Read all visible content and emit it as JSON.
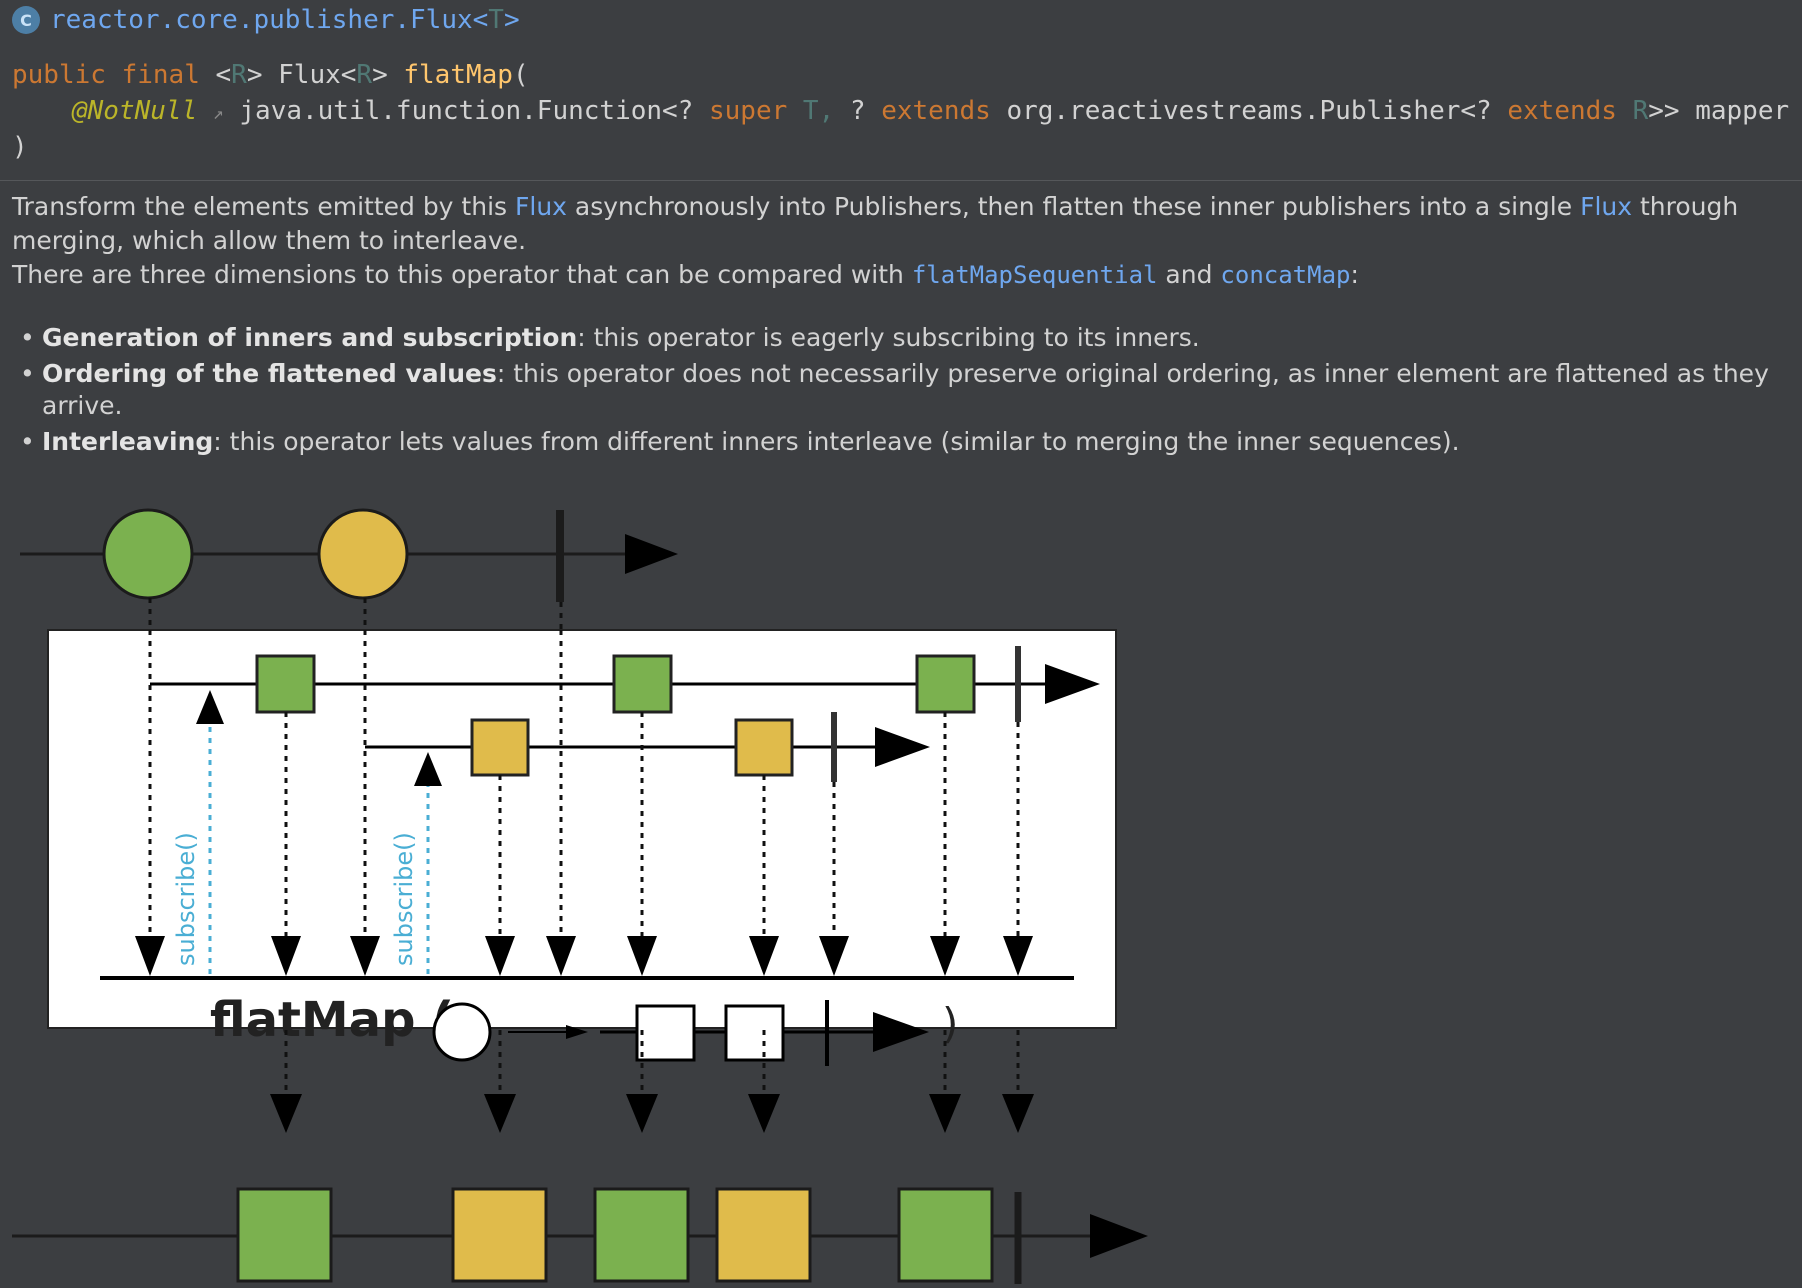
{
  "header": {
    "class_badge": "C",
    "class_name_prefix": "reactor.core.publisher.Flux<",
    "class_name_type": "T",
    "class_name_suffix": ">",
    "signature": {
      "public": "public",
      "final": "final",
      "generic_open": " <",
      "generic_R": "R",
      "generic_close": "> Flux<",
      "return_R": "R",
      "return_close": "> ",
      "method": "flatMap",
      "paren_open": "(",
      "annotation": "@NotNull",
      "ext_icon": "↗",
      "param_type_a": " java.util.function.Function<? ",
      "super": "super",
      "param_T": " T,",
      "param_q": " ? ",
      "extends1": "extends",
      "param_type_b": " org.reactivestreams.Publisher<? ",
      "extends2": "extends",
      "param_R": " R",
      "param_end": ">> mapper",
      "paren_close": ")"
    }
  },
  "doc": {
    "p1_a": "Transform the elements emitted by this ",
    "p1_link1": "Flux",
    "p1_b": " asynchronously into Publishers, then flatten these inner publishers into a single ",
    "p1_link2": "Flux",
    "p1_c": " through merging, which allow them to interleave.",
    "p2_a": "There are three dimensions to this operator that can be compared with ",
    "p2_link1": "flatMapSequential",
    "p2_b": " and ",
    "p2_link2": "concatMap",
    "p2_c": ":",
    "bullet_char": "•",
    "bullets": [
      {
        "bold": "Generation of inners and subscription",
        "text": ": this operator is eagerly subscribing to its inners."
      },
      {
        "bold": "Ordering of the flattened values",
        "text": ": this operator does not necessarily preserve original ordering, as inner element are flattened as they arrive."
      },
      {
        "bold": "Interleaving",
        "text": ": this operator lets values from different inners interleave (similar to merging the inner sequences)."
      }
    ]
  },
  "diagram": {
    "subscribe_label": "subscribe()",
    "operator_label": "flatMap (",
    "operator_close": ")",
    "colors": {
      "green": "#7bb14f",
      "yellow": "#e0bb4b",
      "subscribe_blue": "#4aaed4",
      "panel_bg": "#ffffff",
      "ink": "#111111"
    },
    "output_sequence": [
      "green",
      "yellow",
      "green",
      "yellow",
      "green"
    ]
  }
}
